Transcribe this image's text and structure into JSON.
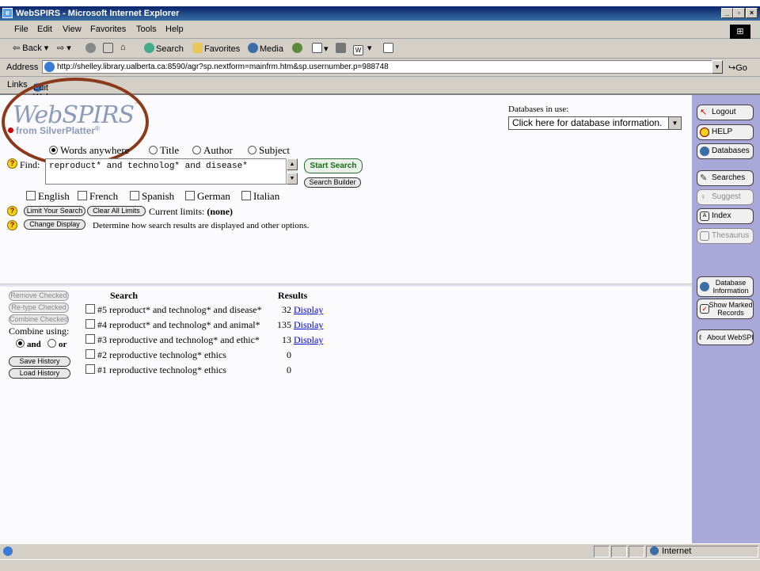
{
  "window": {
    "title": "WebSPIRS - Microsoft Internet Explorer"
  },
  "menu": [
    "File",
    "Edit",
    "View",
    "Favorites",
    "Tools",
    "Help"
  ],
  "toolbar": {
    "back": "Back",
    "search": "Search",
    "favorites": "Favorites",
    "media": "Media"
  },
  "address": {
    "label": "Address",
    "url": "http://shelley.library.ualberta.ca:8590/agr?sp.nextform=mainfrm.htm&sp.usernumber.p=988748",
    "go": "Go"
  },
  "links": {
    "label": "Links",
    "edit": "Edit Web Page"
  },
  "logo": {
    "name": "WebSPIRS",
    "tm": "™",
    "from": "from SilverPlatter",
    "reg": "®"
  },
  "databases": {
    "label": "Databases in use:",
    "select_value": "Click here for database information."
  },
  "search": {
    "fields": [
      "Words anywhere",
      "Title",
      "Author",
      "Subject"
    ],
    "find_label": "Find:",
    "find_value": "reproduct* and technolog* and disease*",
    "start_button": "Start Search",
    "builder_button": "Search Builder",
    "languages": [
      "English",
      "French",
      "Spanish",
      "German",
      "Italian"
    ],
    "limit_button": "Limit Your Search",
    "clear_limits_button": "Clear All Limits",
    "current_limits_label": "Current limits:",
    "current_limits_value": "(none)",
    "change_display_button": "Change Display",
    "change_display_text": "Determine how search results are displayed and other options."
  },
  "history": {
    "remove_checked": "Remove Checked",
    "retype_checked": "Re-type Checked",
    "combine_checked": "Combine Checked",
    "combine_using": "Combine using:",
    "and": "and",
    "or": "or",
    "save_history": "Save History",
    "load_history": "Load History",
    "col_search": "Search",
    "col_results": "Results",
    "rows": [
      {
        "query": "#5 reproduct* and technolog* and disease*",
        "count": "32",
        "link": "Display"
      },
      {
        "query": "#4 reproduct* and technolog* and animal*",
        "count": "135",
        "link": "Display"
      },
      {
        "query": "#3 reproductive and technolog* and ethic*",
        "count": "13",
        "link": "Display"
      },
      {
        "query": "#2 reproductive technolog* ethics",
        "count": "0",
        "link": ""
      },
      {
        "query": "#1 reproductive technolog* ethics",
        "count": "0",
        "link": ""
      }
    ]
  },
  "sidebar": {
    "logout": "Logout",
    "help": "HELP",
    "databases": "Databases",
    "searches": "Searches",
    "suggest": "Suggest",
    "index": "Index",
    "thesaurus": "Thesaurus",
    "database_info_1": "Database",
    "database_info_2": "Information",
    "show_marked_1": "Show Marked",
    "show_marked_2": "Records",
    "about": "About WebSPIRS"
  },
  "status": {
    "zone": "Internet"
  }
}
